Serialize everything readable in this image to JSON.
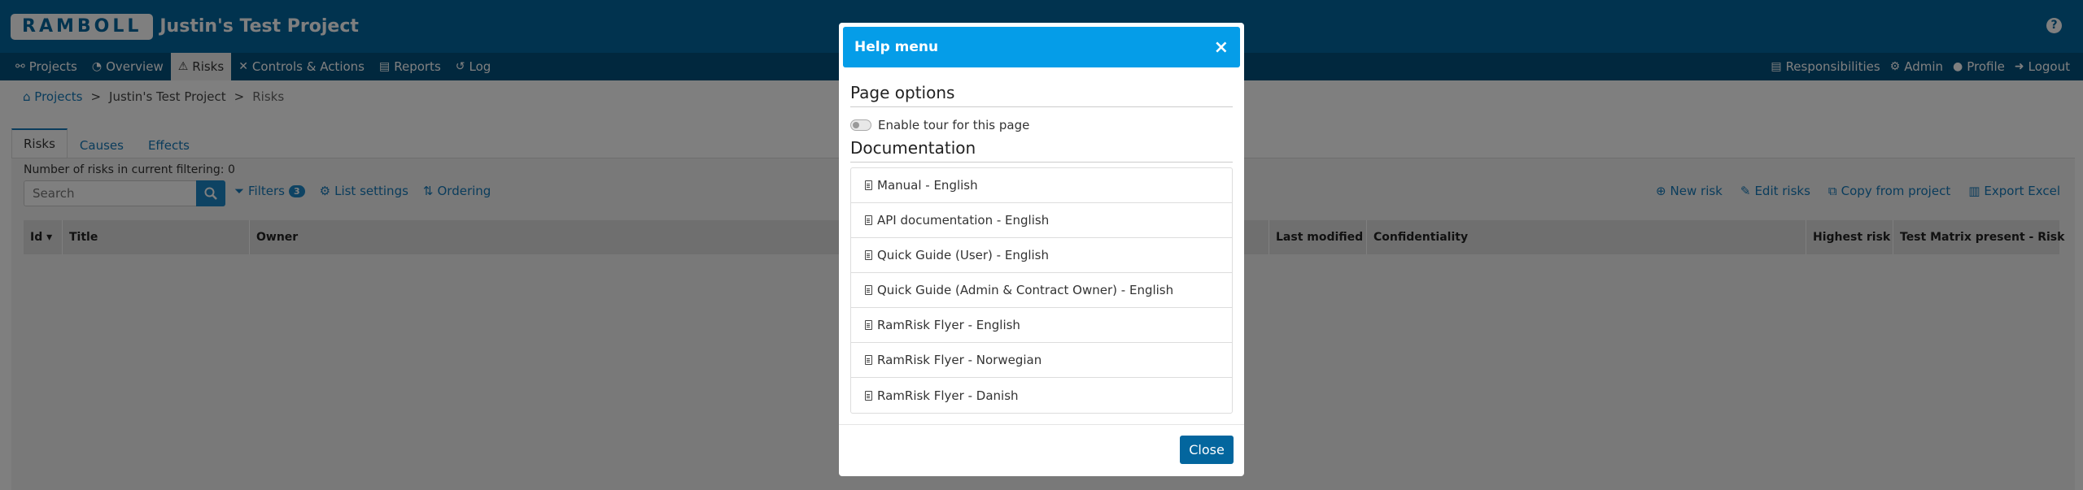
{
  "header": {
    "logo_text": "RAMBOLL",
    "project_title": "Justin's Test Project",
    "help_icon_glyph": "?"
  },
  "nav": {
    "left": [
      {
        "label": "Projects",
        "icon": "projects-icon",
        "glyph": "⚯"
      },
      {
        "label": "Overview",
        "icon": "dashboard-icon",
        "glyph": "◔"
      },
      {
        "label": "Risks",
        "icon": "warning-icon",
        "glyph": "⚠"
      },
      {
        "label": "Controls & Actions",
        "icon": "tools-icon",
        "glyph": "✕"
      },
      {
        "label": "Reports",
        "icon": "file-icon",
        "glyph": "▤"
      },
      {
        "label": "Log",
        "icon": "history-icon",
        "glyph": "↺"
      }
    ],
    "right": [
      {
        "label": "Responsibilities",
        "icon": "clipboard-icon",
        "glyph": "▤"
      },
      {
        "label": "Admin",
        "icon": "user-cog-icon",
        "glyph": "⚙"
      },
      {
        "label": "Profile",
        "icon": "user-icon",
        "glyph": "●"
      },
      {
        "label": "Logout",
        "icon": "logout-icon",
        "glyph": "➜"
      }
    ]
  },
  "breadcrumb": {
    "projects": "Projects",
    "sep": ">",
    "project": "Justin's Test Project",
    "current": "Risks"
  },
  "tabs": [
    "Risks",
    "Causes",
    "Effects"
  ],
  "list": {
    "count_text": "Number of risks in current filtering: 0",
    "search_placeholder": "Search",
    "filters_label": "Filters",
    "filters_count": "3",
    "list_settings_label": "List settings",
    "ordering_label": "Ordering",
    "new_risk_label": "New risk",
    "edit_risks_label": "Edit risks",
    "copy_label": "Copy from project",
    "export_label": "Export Excel"
  },
  "table": {
    "columns": [
      "Id",
      "Title",
      "Owner",
      "Last modified",
      "Confidentiality",
      "Highest risk",
      "Test Matrix present - Risk"
    ]
  },
  "modal": {
    "title": "Help menu",
    "close_x": "×",
    "page_options_title": "Page options",
    "tour_label": "Enable tour for this page",
    "documentation_title": "Documentation",
    "docs": [
      "Manual - English",
      "API documentation - English",
      "Quick Guide (User) - English",
      "Quick Guide (Admin & Contract Owner) - English",
      "RamRisk Flyer - English",
      "RamRisk Flyer - Norwegian",
      "RamRisk Flyer - Danish"
    ],
    "close_label": "Close"
  },
  "colors": {
    "header": "#03669e",
    "nav": "#02507d",
    "modal_header": "#059de8",
    "link": "#1478b8"
  }
}
